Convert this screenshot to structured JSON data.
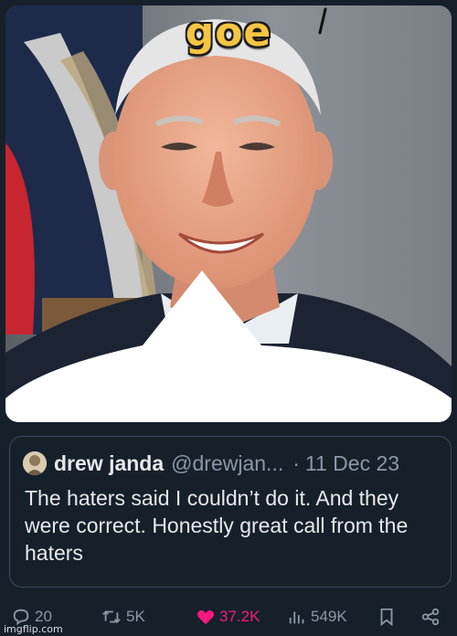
{
  "image": {
    "meme_caption": "goe",
    "alt_description": "Portrait photo with white speech bubble shape at bottom"
  },
  "quote": {
    "author_name": "drew janda",
    "author_handle": "@drewjan...",
    "separator": "·",
    "date": "11 Dec 23",
    "text": "The haters said I couldn’t do it. And they were correct. Honestly great call from the haters"
  },
  "actions": {
    "replies": "20",
    "reposts": "5K",
    "likes": "37.2K",
    "views": "549K"
  },
  "colors": {
    "background": "#15202b",
    "like_active": "#f91880",
    "muted": "#8b98a5",
    "caption": "#f5c542"
  },
  "icons": [
    "reply-icon",
    "repost-icon",
    "like-icon",
    "views-icon",
    "bookmark-icon",
    "share-icon"
  ],
  "watermark": "imgflip.com"
}
